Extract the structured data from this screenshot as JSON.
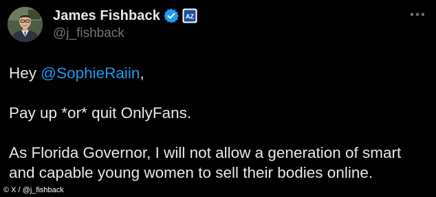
{
  "author": {
    "display_name": "James Fishback",
    "handle": "@j_fishback",
    "affiliate_badge": "AZ"
  },
  "post": {
    "greeting_prefix": "Hey ",
    "mention": "@SophieRaiin",
    "greeting_suffix": ",",
    "line_2": "Pay up *or* quit OnlyFans.",
    "line_3a": "As Florida Governor, I will not allow a generation of smart",
    "line_3b": "and capable young women to sell their bodies online."
  },
  "credit": "© X / @j_fishback",
  "icons": {
    "verified": "verified-check-icon",
    "more": "more-options-icon"
  },
  "colors": {
    "background": "#000000",
    "text": "#e7e9ea",
    "secondary": "#71767b",
    "accent": "#1d9bf0"
  }
}
